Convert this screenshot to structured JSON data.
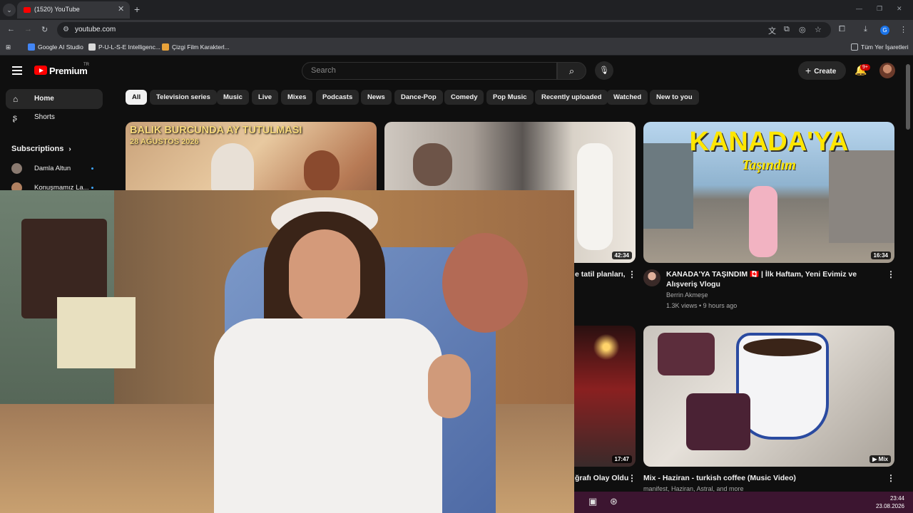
{
  "browser": {
    "tab_title": "(1520) YouTube",
    "url": "youtube.com",
    "bookmarks": [
      "Google AI Studio",
      "P-U-L-S-E Intelligenc...",
      "Çizgi Film Karakterl..."
    ],
    "bookmarks_right": "Tüm Yer İşaretleri"
  },
  "header": {
    "logo": "Premium",
    "logo_region": "TR",
    "search_placeholder": "Search",
    "create_label": "Create",
    "notif_badge": "9+"
  },
  "sidebar": {
    "items": [
      {
        "label": "Home"
      },
      {
        "label": "Shorts"
      }
    ],
    "subscriptions_title": "Subscriptions",
    "subs": [
      {
        "name": "Damla Altun"
      },
      {
        "name": "Konuşmamız La..."
      }
    ]
  },
  "chips": [
    "All",
    "Television series",
    "Music",
    "Live",
    "Mixes",
    "Podcasts",
    "News",
    "Dance-Pop",
    "Comedy",
    "Pop Music",
    "Recently uploaded",
    "Watched",
    "New to you"
  ],
  "videos": {
    "v1": {
      "thumb_text_1": "BALIK BURCUNDA AY TUTULMASI",
      "thumb_text_2": "28 AĞUSTOS 2026"
    },
    "v2": {
      "duration": "42:34",
      "title_partial": "e tatil planları,"
    },
    "v3": {
      "thumb_text_1": "KANADA'YA",
      "thumb_text_2": "Taşındım",
      "duration": "16:34",
      "title": "KANADA'YA TAŞINDIM 🇨🇦 | İlk Haftam, Yeni Evimiz ve Alışveriş Vlogu",
      "channel": "Berrin Akmeşe",
      "meta": "1.3K views • 9 hours ago"
    },
    "v5": {
      "duration": "17:47",
      "title_partial": "ğrafı Olay Oldu"
    },
    "v6": {
      "badge": "Mix",
      "title": "Mix - Haziran - turkish coffee (Music Video)",
      "meta": "manifest, Haziran, Astral, and more"
    }
  },
  "taskbar": {
    "time": "23:44",
    "date": "23.08.2026"
  },
  "colors": {
    "brand_red": "#ff0000",
    "bg": "#0f0f0f",
    "chip_bg": "#272727"
  }
}
